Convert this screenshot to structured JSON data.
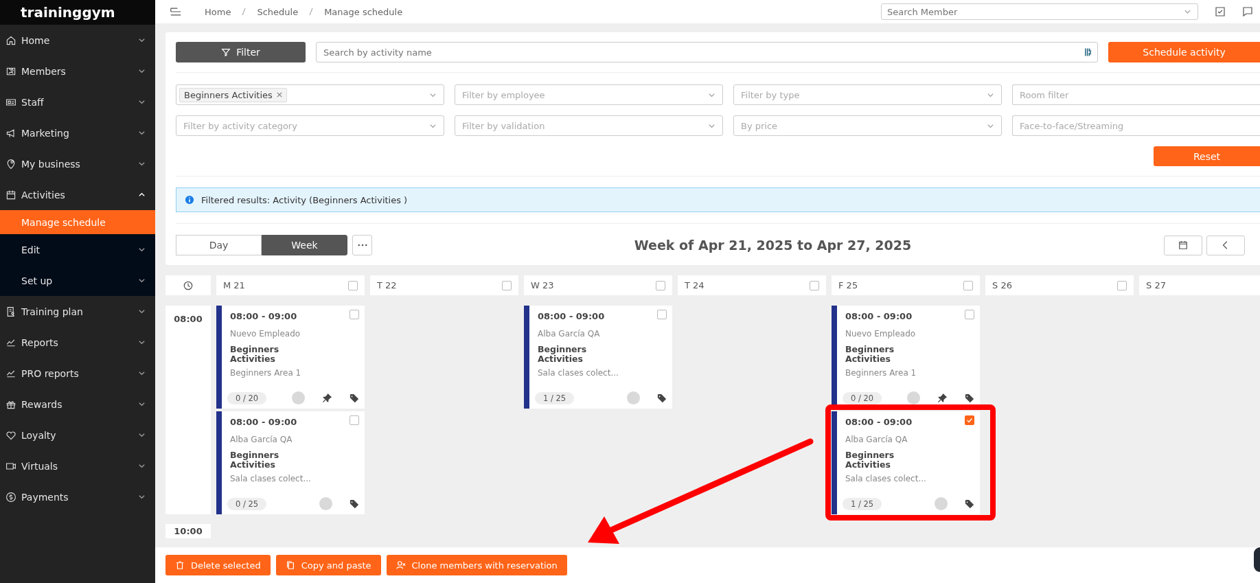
{
  "brand": "traininggym",
  "breadcrumb": [
    "Home",
    "Schedule",
    "Manage schedule"
  ],
  "member_search": {
    "placeholder": "Search Member"
  },
  "sidebar": {
    "items": [
      {
        "label": "Home",
        "expanded": false
      },
      {
        "label": "Members",
        "expanded": false
      },
      {
        "label": "Staff",
        "expanded": false
      },
      {
        "label": "Marketing",
        "expanded": false
      },
      {
        "label": "My business",
        "expanded": false
      },
      {
        "label": "Activities",
        "expanded": true,
        "children": [
          {
            "label": "Manage schedule",
            "selected": true
          },
          {
            "label": "Edit",
            "selected": false
          },
          {
            "label": "Set up",
            "selected": false
          }
        ]
      },
      {
        "label": "Training plan",
        "expanded": false
      },
      {
        "label": "Reports",
        "expanded": false
      },
      {
        "label": "PRO reports",
        "expanded": false
      },
      {
        "label": "Rewards",
        "expanded": false
      },
      {
        "label": "Loyalty",
        "expanded": false
      },
      {
        "label": "Virtuals",
        "expanded": false
      },
      {
        "label": "Payments",
        "expanded": false
      }
    ]
  },
  "filter_button": "Filter",
  "search": {
    "placeholder": "Search by activity name"
  },
  "schedule_button": "Schedule activity",
  "filters": [
    {
      "kind": "tags",
      "tags": [
        "Beginners Activities"
      ]
    },
    {
      "kind": "select",
      "placeholder": "Filter by employee"
    },
    {
      "kind": "select",
      "placeholder": "Filter by type"
    },
    {
      "kind": "input",
      "placeholder": "Room filter"
    },
    {
      "kind": "select",
      "placeholder": "Filter by activity category"
    },
    {
      "kind": "select",
      "placeholder": "Filter by validation"
    },
    {
      "kind": "select",
      "placeholder": "By price"
    },
    {
      "kind": "input",
      "placeholder": "Face-to-face/Streaming"
    }
  ],
  "reset_button": "Reset",
  "alert": "Filtered results: Activity (Beginners Activities )",
  "view_tabs": [
    {
      "label": "Day",
      "selected": false
    },
    {
      "label": "Week",
      "selected": true
    }
  ],
  "week_title": "Week of Apr 21, 2025 to Apr 27, 2025",
  "times": [
    "08:00",
    "10:00"
  ],
  "days": [
    {
      "label": "M 21",
      "checked": false,
      "events": [
        {
          "time": "08:00 - 09:00",
          "employee": "Nuevo Empleado",
          "activity": "Beginners Activities",
          "room": "Beginners Area 1",
          "capacity": "0 / 20",
          "pinned": true,
          "checked": false
        },
        {
          "time": "08:00 - 09:00",
          "employee": "Alba García QA",
          "activity": "Beginners Activities",
          "room": "Sala clases colect...",
          "capacity": "0 / 25",
          "pinned": false,
          "checked": false
        }
      ]
    },
    {
      "label": "T 22",
      "checked": false
    },
    {
      "label": "W 23",
      "checked": false,
      "events": [
        {
          "time": "08:00 - 09:00",
          "employee": "Alba García QA",
          "activity": "Beginners Activities",
          "room": "Sala clases colect...",
          "capacity": "1 / 25",
          "pinned": false,
          "checked": false
        }
      ]
    },
    {
      "label": "T 24",
      "checked": false
    },
    {
      "label": "F 25",
      "checked": false,
      "events": [
        {
          "time": "08:00 - 09:00",
          "employee": "Nuevo Empleado",
          "activity": "Beginners Activities",
          "room": "Beginners Area 1",
          "capacity": "0 / 20",
          "pinned": true,
          "checked": false
        },
        {
          "time": "08:00 - 09:00",
          "employee": "Alba García QA",
          "activity": "Beginners Activities",
          "room": "Sala clases colect...",
          "capacity": "1 / 25",
          "pinned": false,
          "checked": true
        }
      ]
    },
    {
      "label": "S 26",
      "checked": false
    },
    {
      "label": "S 27"
    }
  ],
  "actions": [
    "Delete selected",
    "Copy and paste",
    "Clone members with reservation"
  ]
}
